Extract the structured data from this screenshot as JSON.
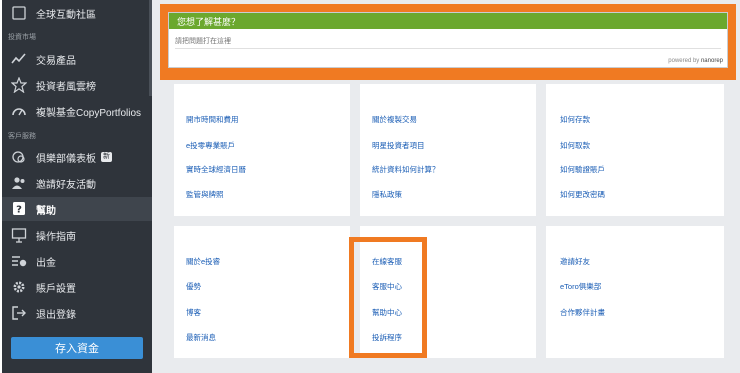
{
  "sidebar": {
    "top_item": "全球互動社區",
    "section_market": "投資市場",
    "market_items": [
      "交易產品",
      "投資者風雲榜",
      "複製基金CopyPortfolios"
    ],
    "section_service": "客戶服務",
    "service_items": [
      "俱樂部儀表板",
      "邀請好友活動",
      "幫助",
      "操作指南",
      "出金",
      "賬戶設置",
      "退出登錄"
    ],
    "club_badge": "新",
    "deposit_button": "存入資金"
  },
  "question_widget": {
    "title": "您想了解甚麼？",
    "placeholder": "請把問題打在這裡",
    "powered_by": "powered by",
    "brand": "nanorep"
  },
  "link_cards": {
    "row1": {
      "col1": [
        "開市時間和費用",
        "e投零專業賬戶",
        "實時全球經濟日曆",
        "監管與牌照"
      ],
      "col2": [
        "關於複製交易",
        "明星投資者項目",
        "統計資料如何計算？",
        "隱私政策"
      ],
      "col3": [
        "如何存款",
        "如何取款",
        "如何驗證賬戶",
        "如何更改密碼"
      ]
    },
    "row2": {
      "col1": [
        "關於e投睿",
        "優勢",
        "博客",
        "最新消息"
      ],
      "col2": [
        "在線客服",
        "客服中心",
        "幫助中心",
        "投訴程序"
      ],
      "col3": [
        "邀請好友",
        "eToro俱樂部",
        "合作夥伴計畫"
      ]
    }
  },
  "colors": {
    "sidebar_bg": "#2f343b",
    "highlight": "#f07a22",
    "widget_header": "#6ba82e",
    "link": "#1a5db5",
    "deposit": "#3a8fd6"
  }
}
